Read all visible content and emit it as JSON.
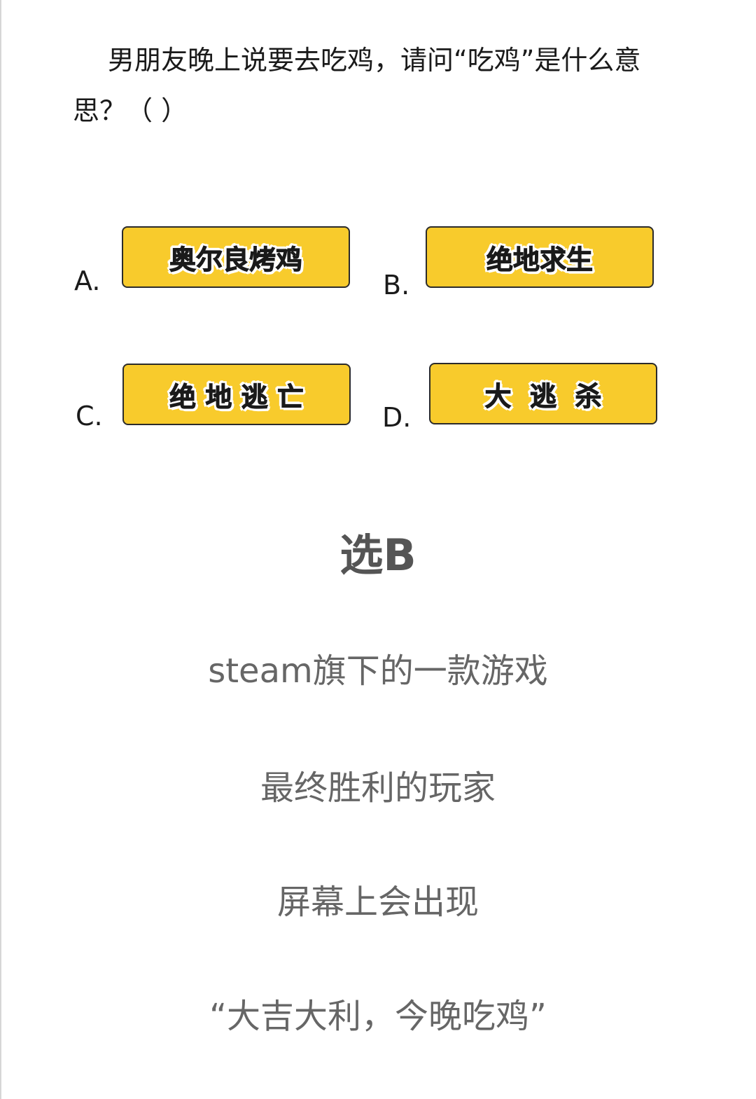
{
  "question": {
    "text": "男朋友晚上说要去吃鸡，请问“吃鸡”是什么意思？（      ）"
  },
  "options": [
    {
      "letter": "A.",
      "label": "奥尔良烤鸡"
    },
    {
      "letter": "B.",
      "label": "绝地求生"
    },
    {
      "letter": "C.",
      "label": "绝 地 逃 亡"
    },
    {
      "letter": "D.",
      "label": "大  逃  杀"
    }
  ],
  "answer": {
    "text": "选B"
  },
  "explanation": [
    "steam旗下的一款游戏",
    "最终胜利的玩家",
    "屏幕上会出现",
    "“大吉大利，今晚吃鸡”"
  ],
  "colors": {
    "button_fill": "#f8cb2c",
    "button_border": "#2b2b2b",
    "answer_text": "#555555",
    "explanation_text": "#666666"
  }
}
